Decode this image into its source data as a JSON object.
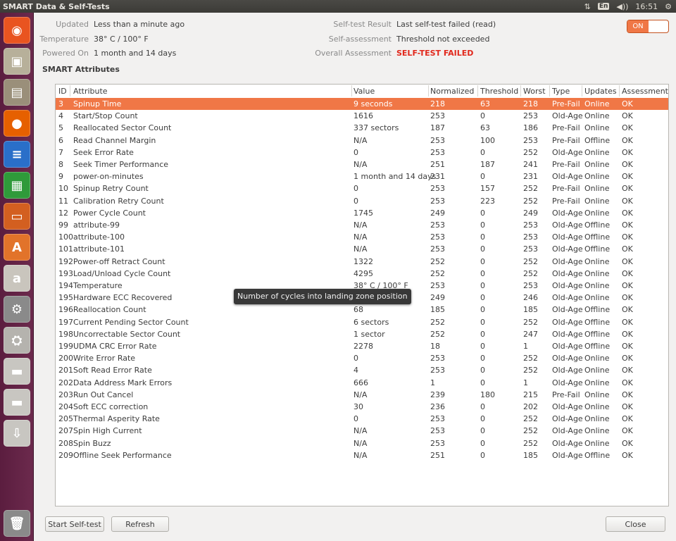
{
  "window": {
    "title": "SMART Data & Self-Tests"
  },
  "tray": {
    "keyboard": "En",
    "volume_icon": "volume-icon",
    "network_icon": "network-icon",
    "clock": "16:51",
    "settings_icon": "gear-icon"
  },
  "info": {
    "updated_label": "Updated",
    "updated_value": "Less than a minute ago",
    "temperature_label": "Temperature",
    "temperature_value": "38° C / 100° F",
    "powered_on_label": "Powered On",
    "powered_on_value": "1 month and 14 days",
    "selftest_label": "Self-test Result",
    "selftest_value": "Last self-test failed (read)",
    "selfassessment_label": "Self-assessment",
    "selfassessment_value": "Threshold not exceeded",
    "overall_label": "Overall Assessment",
    "overall_value": "SELF-TEST FAILED",
    "toggle_label": "ON"
  },
  "section_title": "SMART Attributes",
  "table": {
    "headers": [
      "ID",
      "Attribute",
      "Value",
      "Normalized",
      "Threshold",
      "Worst",
      "Type",
      "Updates",
      "Assessment"
    ],
    "rows": [
      [
        "3",
        "Spinup Time",
        "9 seconds",
        "218",
        "63",
        "218",
        "Pre-Fail",
        "Online",
        "OK"
      ],
      [
        "4",
        "Start/Stop Count",
        "1616",
        "253",
        "0",
        "253",
        "Old-Age",
        "Online",
        "OK"
      ],
      [
        "5",
        "Reallocated Sector Count",
        "337 sectors",
        "187",
        "63",
        "186",
        "Pre-Fail",
        "Online",
        "OK"
      ],
      [
        "6",
        "Read Channel Margin",
        "N/A",
        "253",
        "100",
        "253",
        "Pre-Fail",
        "Offline",
        "OK"
      ],
      [
        "7",
        "Seek Error Rate",
        "0",
        "253",
        "0",
        "252",
        "Old-Age",
        "Online",
        "OK"
      ],
      [
        "8",
        "Seek Timer Performance",
        "N/A",
        "251",
        "187",
        "241",
        "Pre-Fail",
        "Online",
        "OK"
      ],
      [
        "9",
        "power-on-minutes",
        "1 month and 14 days",
        "231",
        "0",
        "231",
        "Old-Age",
        "Online",
        "OK"
      ],
      [
        "10",
        "Spinup Retry Count",
        "0",
        "253",
        "157",
        "252",
        "Pre-Fail",
        "Online",
        "OK"
      ],
      [
        "11",
        "Calibration Retry Count",
        "0",
        "253",
        "223",
        "252",
        "Pre-Fail",
        "Online",
        "OK"
      ],
      [
        "12",
        "Power Cycle Count",
        "1745",
        "249",
        "0",
        "249",
        "Old-Age",
        "Online",
        "OK"
      ],
      [
        "99",
        "attribute-99",
        "N/A",
        "253",
        "0",
        "253",
        "Old-Age",
        "Offline",
        "OK"
      ],
      [
        "100",
        "attribute-100",
        "N/A",
        "253",
        "0",
        "253",
        "Old-Age",
        "Offline",
        "OK"
      ],
      [
        "101",
        "attribute-101",
        "N/A",
        "253",
        "0",
        "253",
        "Old-Age",
        "Offline",
        "OK"
      ],
      [
        "192",
        "Power-off Retract Count",
        "1322",
        "252",
        "0",
        "252",
        "Old-Age",
        "Online",
        "OK"
      ],
      [
        "193",
        "Load/Unload Cycle Count",
        "4295",
        "252",
        "0",
        "252",
        "Old-Age",
        "Online",
        "OK"
      ],
      [
        "194",
        "Temperature",
        "38° C / 100° F",
        "253",
        "0",
        "253",
        "Old-Age",
        "Online",
        "OK"
      ],
      [
        "195",
        "Hardware ECC Recovered",
        "",
        "249",
        "0",
        "246",
        "Old-Age",
        "Online",
        "OK"
      ],
      [
        "196",
        "Reallocation Count",
        "68",
        "185",
        "0",
        "185",
        "Old-Age",
        "Offline",
        "OK"
      ],
      [
        "197",
        "Current Pending Sector Count",
        "6 sectors",
        "252",
        "0",
        "252",
        "Old-Age",
        "Offline",
        "OK"
      ],
      [
        "198",
        "Uncorrectable Sector Count",
        "1 sector",
        "252",
        "0",
        "247",
        "Old-Age",
        "Offline",
        "OK"
      ],
      [
        "199",
        "UDMA CRC Error Rate",
        "2278",
        "18",
        "0",
        "1",
        "Old-Age",
        "Offline",
        "OK"
      ],
      [
        "200",
        "Write Error Rate",
        "0",
        "253",
        "0",
        "252",
        "Old-Age",
        "Online",
        "OK"
      ],
      [
        "201",
        "Soft Read Error Rate",
        "4",
        "253",
        "0",
        "252",
        "Old-Age",
        "Online",
        "OK"
      ],
      [
        "202",
        "Data Address Mark Errors",
        "666",
        "1",
        "0",
        "1",
        "Old-Age",
        "Online",
        "OK"
      ],
      [
        "203",
        "Run Out Cancel",
        "N/A",
        "239",
        "180",
        "215",
        "Pre-Fail",
        "Online",
        "OK"
      ],
      [
        "204",
        "Soft ECC correction",
        "30",
        "236",
        "0",
        "202",
        "Old-Age",
        "Online",
        "OK"
      ],
      [
        "205",
        "Thermal Asperity Rate",
        "0",
        "253",
        "0",
        "252",
        "Old-Age",
        "Online",
        "OK"
      ],
      [
        "207",
        "Spin High Current",
        "N/A",
        "253",
        "0",
        "252",
        "Old-Age",
        "Online",
        "OK"
      ],
      [
        "208",
        "Spin Buzz",
        "N/A",
        "253",
        "0",
        "252",
        "Old-Age",
        "Online",
        "OK"
      ],
      [
        "209",
        "Offline Seek Performance",
        "N/A",
        "251",
        "0",
        "185",
        "Old-Age",
        "Offline",
        "OK"
      ]
    ],
    "selected_row": 0
  },
  "tooltip": "Number of cycles into landing zone position",
  "buttons": {
    "start_selftest": "Start Self-test",
    "refresh": "Refresh",
    "close": "Close"
  },
  "launcher": [
    {
      "name": "ubuntu-dash-icon",
      "glyph": "◉",
      "color": "#e95420"
    },
    {
      "name": "shotwell-icon",
      "glyph": "▣",
      "color": "#b7b09a"
    },
    {
      "name": "files-icon",
      "glyph": "▤",
      "color": "#9a8f7a"
    },
    {
      "name": "firefox-icon",
      "glyph": "●",
      "color": "#e66000"
    },
    {
      "name": "writer-icon",
      "glyph": "≡",
      "color": "#2a6fc9"
    },
    {
      "name": "calc-icon",
      "glyph": "▦",
      "color": "#2f9a3a"
    },
    {
      "name": "impress-icon",
      "glyph": "▭",
      "color": "#d35f20"
    },
    {
      "name": "software-center-icon",
      "glyph": "A",
      "color": "#e2732a"
    },
    {
      "name": "amazon-icon",
      "glyph": "a",
      "color": "#c9c5bd"
    },
    {
      "name": "system-settings-icon",
      "glyph": "⚙",
      "color": "#8a8a8a"
    },
    {
      "name": "disks-icon",
      "glyph": "⛭",
      "color": "#b5b3ae"
    },
    {
      "name": "drive-icon",
      "glyph": "▬",
      "color": "#c8c6c1"
    },
    {
      "name": "drive2-icon",
      "glyph": "▬",
      "color": "#c8c6c1"
    },
    {
      "name": "usb-icon",
      "glyph": "⇩",
      "color": "#c8c6c1"
    },
    {
      "name": "trash-icon",
      "glyph": "🗑",
      "color": "#8a8a8a"
    }
  ]
}
